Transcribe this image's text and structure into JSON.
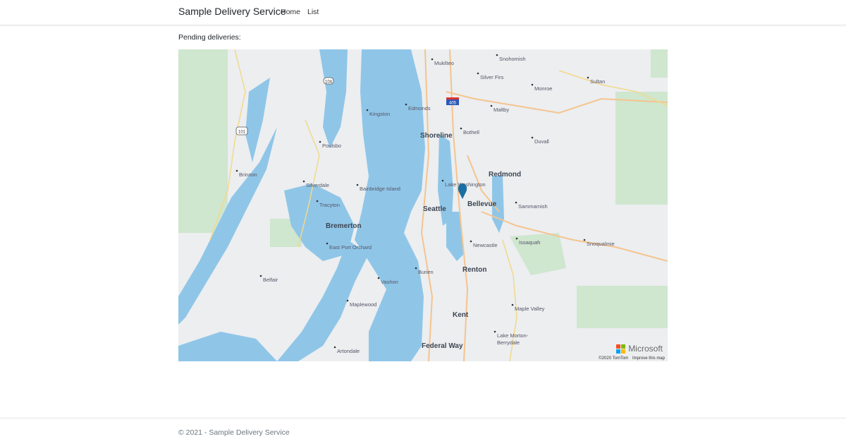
{
  "navbar": {
    "brand": "Sample Delivery Service",
    "links": [
      "Home",
      "List"
    ]
  },
  "main": {
    "heading": "Pending deliveries:"
  },
  "map": {
    "labels": [
      {
        "text": "Mukilteo",
        "big": false
      },
      {
        "text": "Snohomish",
        "big": false
      },
      {
        "text": "Silver Firs",
        "big": false
      },
      {
        "text": "Monroe",
        "big": false
      },
      {
        "text": "Sultan",
        "big": false
      },
      {
        "text": "Edmonds",
        "big": false
      },
      {
        "text": "Kingston",
        "big": false
      },
      {
        "text": "Maltby",
        "big": false
      },
      {
        "text": "Shoreline",
        "big": true
      },
      {
        "text": "Bothell",
        "big": false
      },
      {
        "text": "Duvall",
        "big": false
      },
      {
        "text": "Poulsbo",
        "big": false
      },
      {
        "text": "Brinnon",
        "big": false
      },
      {
        "text": "Redmond",
        "big": true
      },
      {
        "text": "Silverdale",
        "big": false
      },
      {
        "text": "Bainbridge Island",
        "big": false
      },
      {
        "text": "Lake Washington",
        "big": false
      },
      {
        "text": "Tracyton",
        "big": false
      },
      {
        "text": "Seattle",
        "big": true
      },
      {
        "text": "Bellevue",
        "big": true
      },
      {
        "text": "Sammamish",
        "big": false
      },
      {
        "text": "Bremerton",
        "big": true
      },
      {
        "text": "East Port Orchard",
        "big": false
      },
      {
        "text": "Newcastle",
        "big": false
      },
      {
        "text": "Issaquah",
        "big": false
      },
      {
        "text": "Snoqualmie",
        "big": false
      },
      {
        "text": "Burien",
        "big": false
      },
      {
        "text": "Renton",
        "big": true
      },
      {
        "text": "Belfair",
        "big": false
      },
      {
        "text": "Vashon",
        "big": false
      },
      {
        "text": "Maplewood",
        "big": false
      },
      {
        "text": "Maple Valley",
        "big": false
      },
      {
        "text": "Kent",
        "big": true
      },
      {
        "text": "Lake Morton-",
        "big": false
      },
      {
        "text": "Berrydale",
        "big": false
      },
      {
        "text": "Artondale",
        "big": false
      },
      {
        "text": "Federal Way",
        "big": true
      }
    ],
    "shields": [
      "104",
      "101",
      "405"
    ],
    "logo_text": "Microsoft",
    "attribution": "©2020 TomTom",
    "improve_link": "Improve this map",
    "colors": {
      "water": "#8fc6e8",
      "land": "#eceef0",
      "park": "#cfe6cf",
      "pin": "#1b6ea3"
    }
  },
  "footer": {
    "text": "© 2021 - Sample Delivery Service"
  }
}
